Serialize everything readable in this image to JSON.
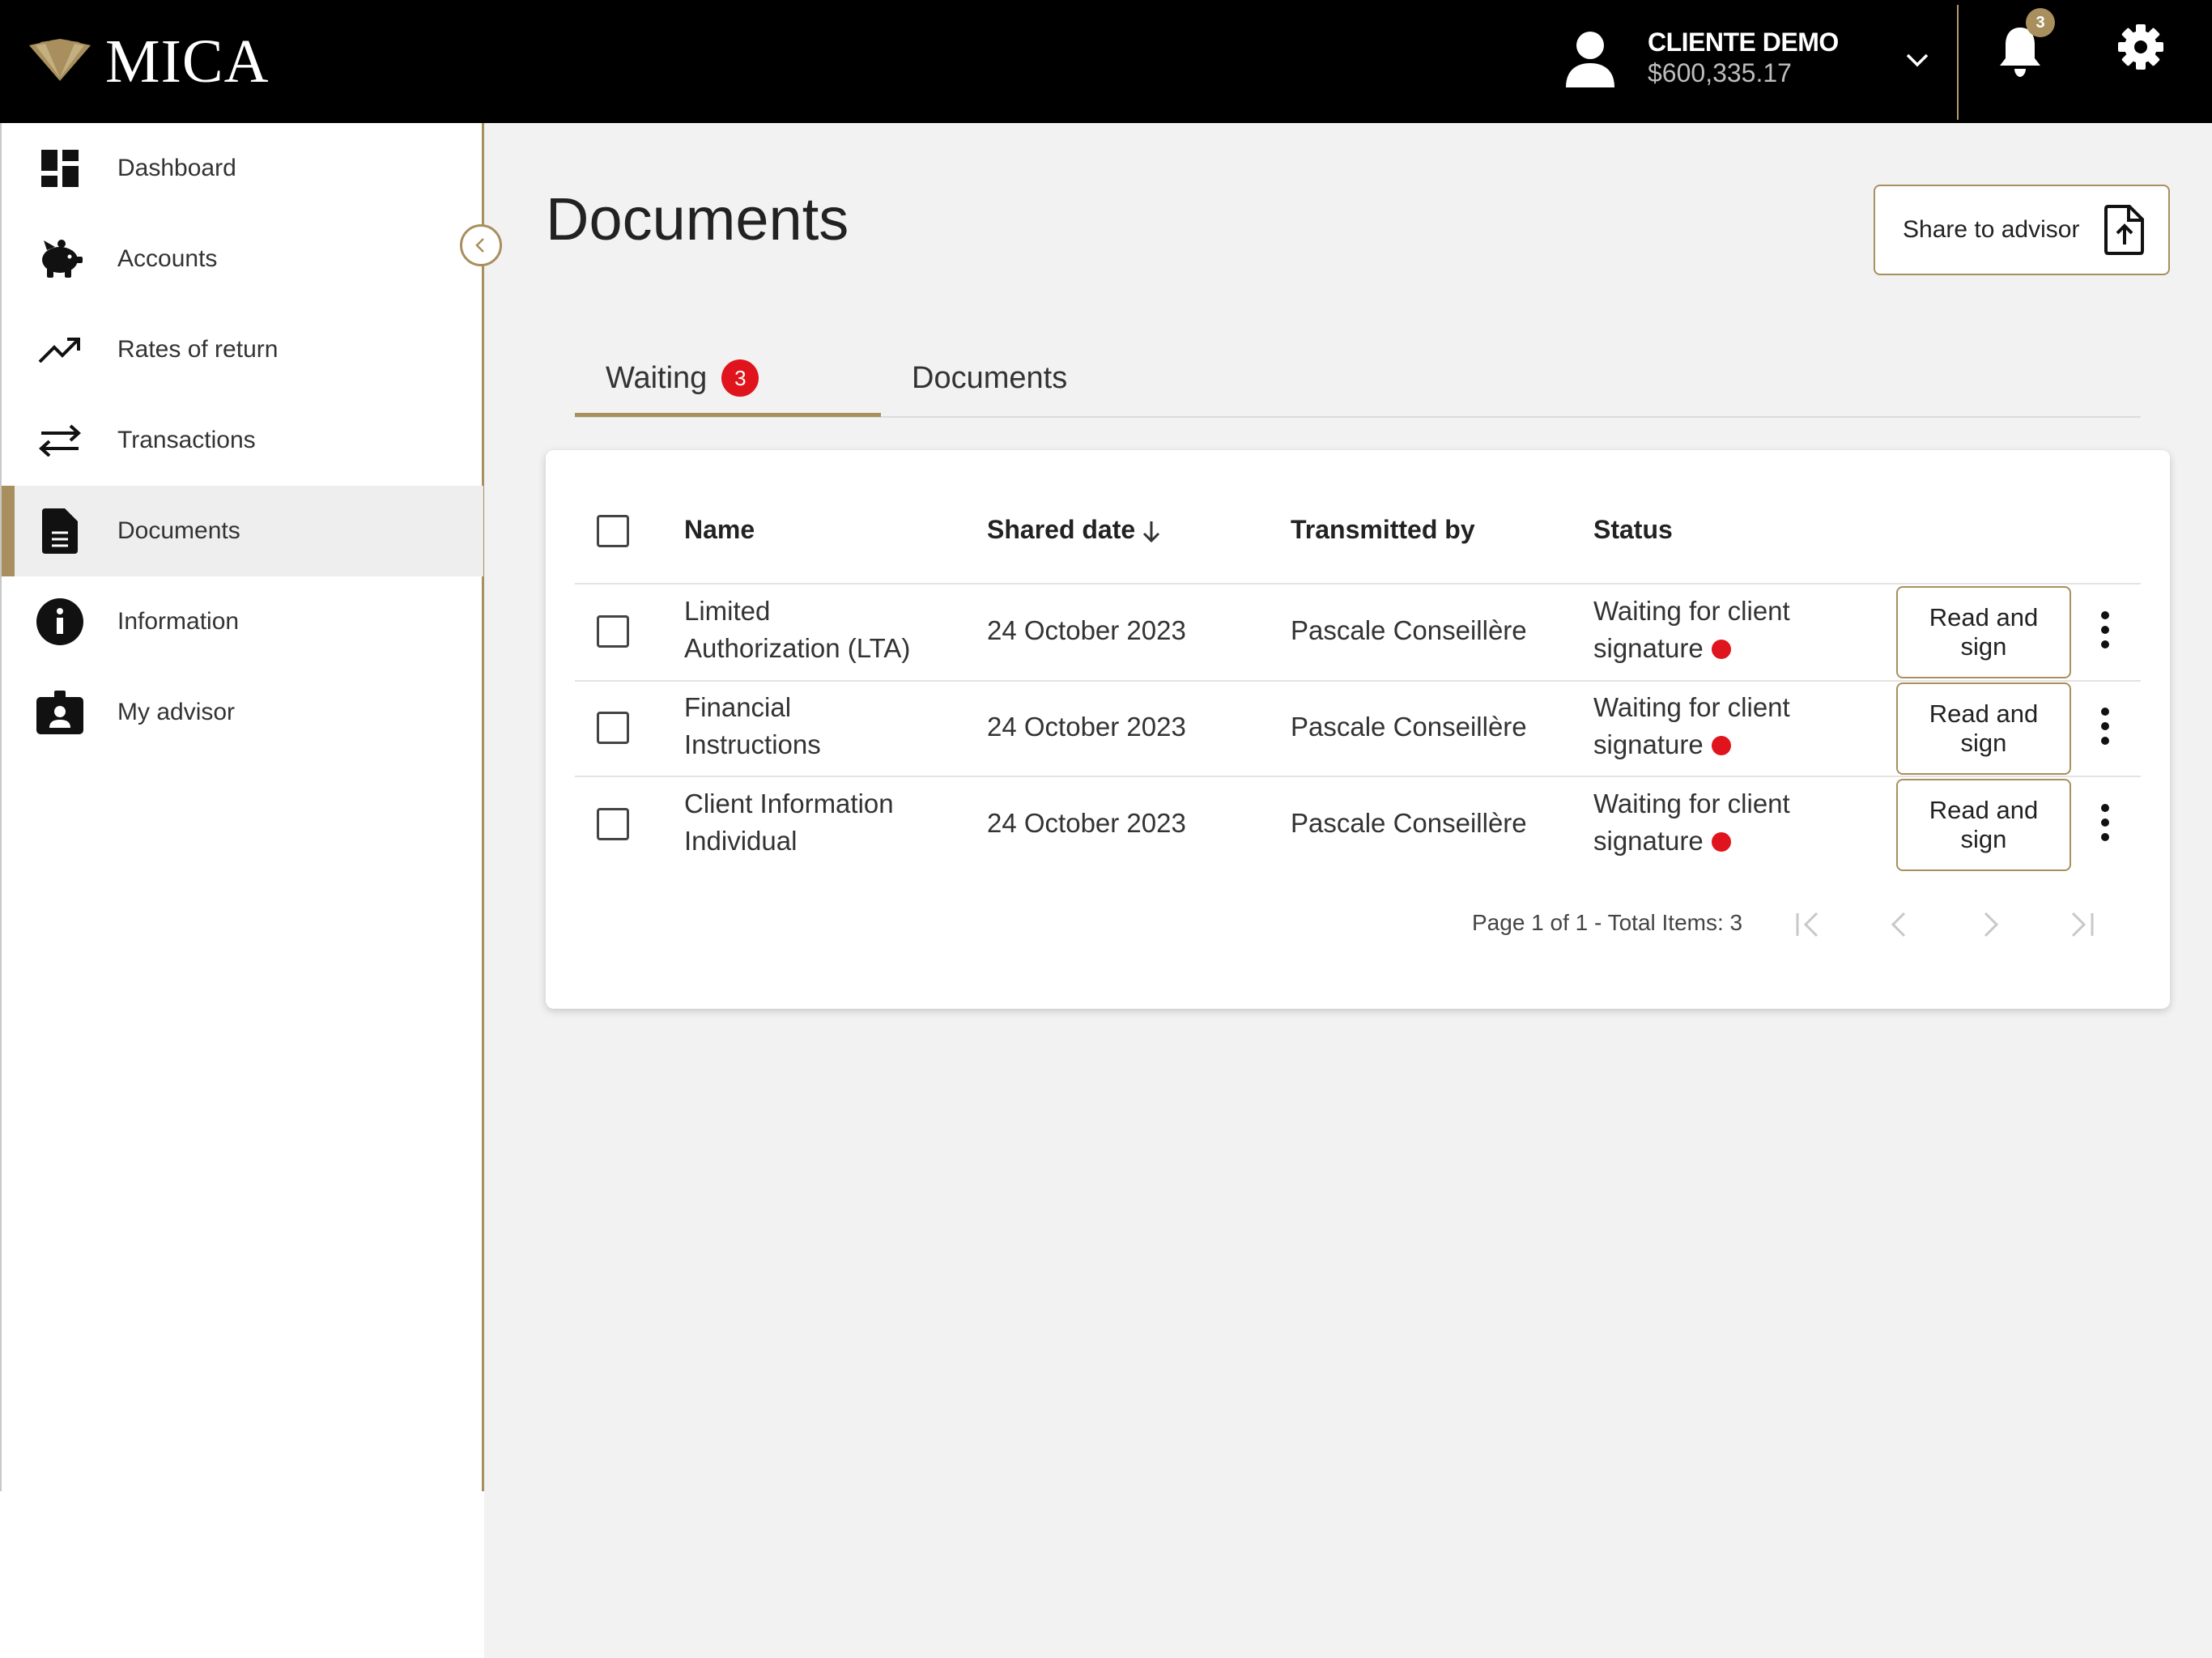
{
  "app": {
    "name": "MICA",
    "brand_color": "#a88f5d",
    "alert_color": "#e0141c"
  },
  "header": {
    "user_name": "CLIENTE DEMO",
    "user_balance": "$600,335.17",
    "notification_count": "3"
  },
  "sidebar": {
    "items": [
      {
        "label": "Dashboard",
        "icon": "dashboard-icon"
      },
      {
        "label": "Accounts",
        "icon": "piggy-bank-icon"
      },
      {
        "label": "Rates of return",
        "icon": "trending-up-icon"
      },
      {
        "label": "Transactions",
        "icon": "swap-arrows-icon"
      },
      {
        "label": "Documents",
        "icon": "document-icon",
        "active": true
      },
      {
        "label": "Information",
        "icon": "info-icon"
      },
      {
        "label": "My advisor",
        "icon": "advisor-badge-icon"
      }
    ]
  },
  "page": {
    "title": "Documents",
    "share_button": "Share to advisor"
  },
  "tabs": [
    {
      "label": "Waiting",
      "badge": "3",
      "active": true
    },
    {
      "label": "Documents"
    }
  ],
  "table": {
    "columns": [
      "Name",
      "Shared date",
      "Transmitted by",
      "Status"
    ],
    "rows": [
      {
        "name_line1": "Limited",
        "name_line2": "Authorization (LTA)",
        "date": "24 October 2023",
        "by": "Pascale Conseillère",
        "status_line1": "Waiting for client",
        "status_line2": "signature",
        "action_line1": "Read and",
        "action_line2": "sign"
      },
      {
        "name_line1": "Financial",
        "name_line2": "Instructions",
        "date": "24 October 2023",
        "by": "Pascale Conseillère",
        "status_line1": "Waiting for client",
        "status_line2": "signature",
        "action_line1": "Read and",
        "action_line2": "sign"
      },
      {
        "name_line1": "Client Information",
        "name_line2": "Individual",
        "date": "24 October 2023",
        "by": "Pascale Conseillère",
        "status_line1": "Waiting for client",
        "status_line2": "signature",
        "action_line1": "Read and",
        "action_line2": "sign"
      }
    ],
    "pagination": "Page 1 of 1 - Total Items: 3"
  }
}
